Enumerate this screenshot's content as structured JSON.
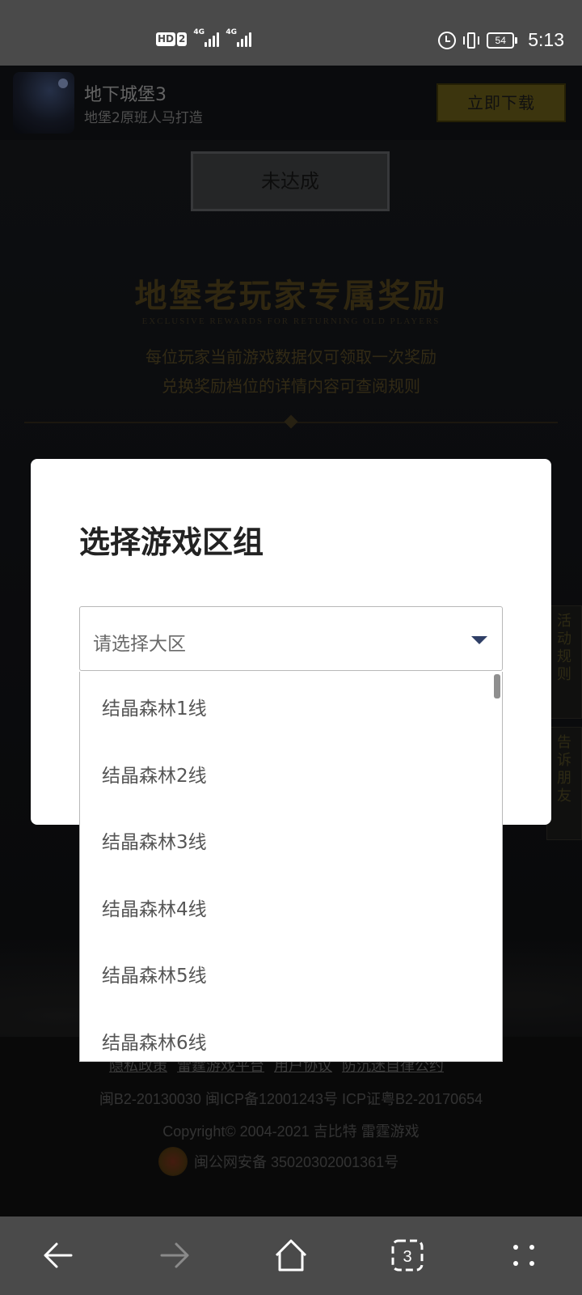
{
  "status_bar": {
    "network_badges": [
      "HD",
      "2"
    ],
    "signal1_tag": "4G",
    "signal2_tag": "4G",
    "battery": "54",
    "time": "5:13"
  },
  "app_banner": {
    "title": "地下城堡3",
    "subtitle": "地堡2原班人马打造",
    "download_label": "立即下载"
  },
  "hero": {
    "status_label": "未达成",
    "promo_title": "地堡老玩家专属奖励",
    "promo_en": "EXCLUSIVE REWARDS FOR RETURNING OLD PLAYERS",
    "promo_desc_1": "每位玩家当前游戏数据仅可领取一次奖励",
    "promo_desc_2": "兑换奖励档位的详情内容可查阅规则",
    "side_tab_rules": [
      "活",
      "动",
      "规",
      "则"
    ],
    "side_tab_share": [
      "告",
      "诉",
      "朋",
      "友"
    ]
  },
  "dialog": {
    "title": "选择游戏区组",
    "select_placeholder": "请选择大区",
    "options": [
      "结晶森林1线",
      "结晶森林2线",
      "结晶森林3线",
      "结晶森林4线",
      "结晶森林5线",
      "结晶森林6线"
    ]
  },
  "footer": {
    "links": [
      "隐私政策",
      "雷霆游戏平台",
      "用户协议",
      "防沉迷自律公约"
    ],
    "license": "闽B2-20130030  闽ICP备12001243号  ICP证粤B2-20170654",
    "copyright": "Copyright© 2004-2021  吉比特  雷霆游戏",
    "police": "闽公网安备 35020302001361号"
  },
  "nav_bar": {
    "tab_count": "3"
  }
}
